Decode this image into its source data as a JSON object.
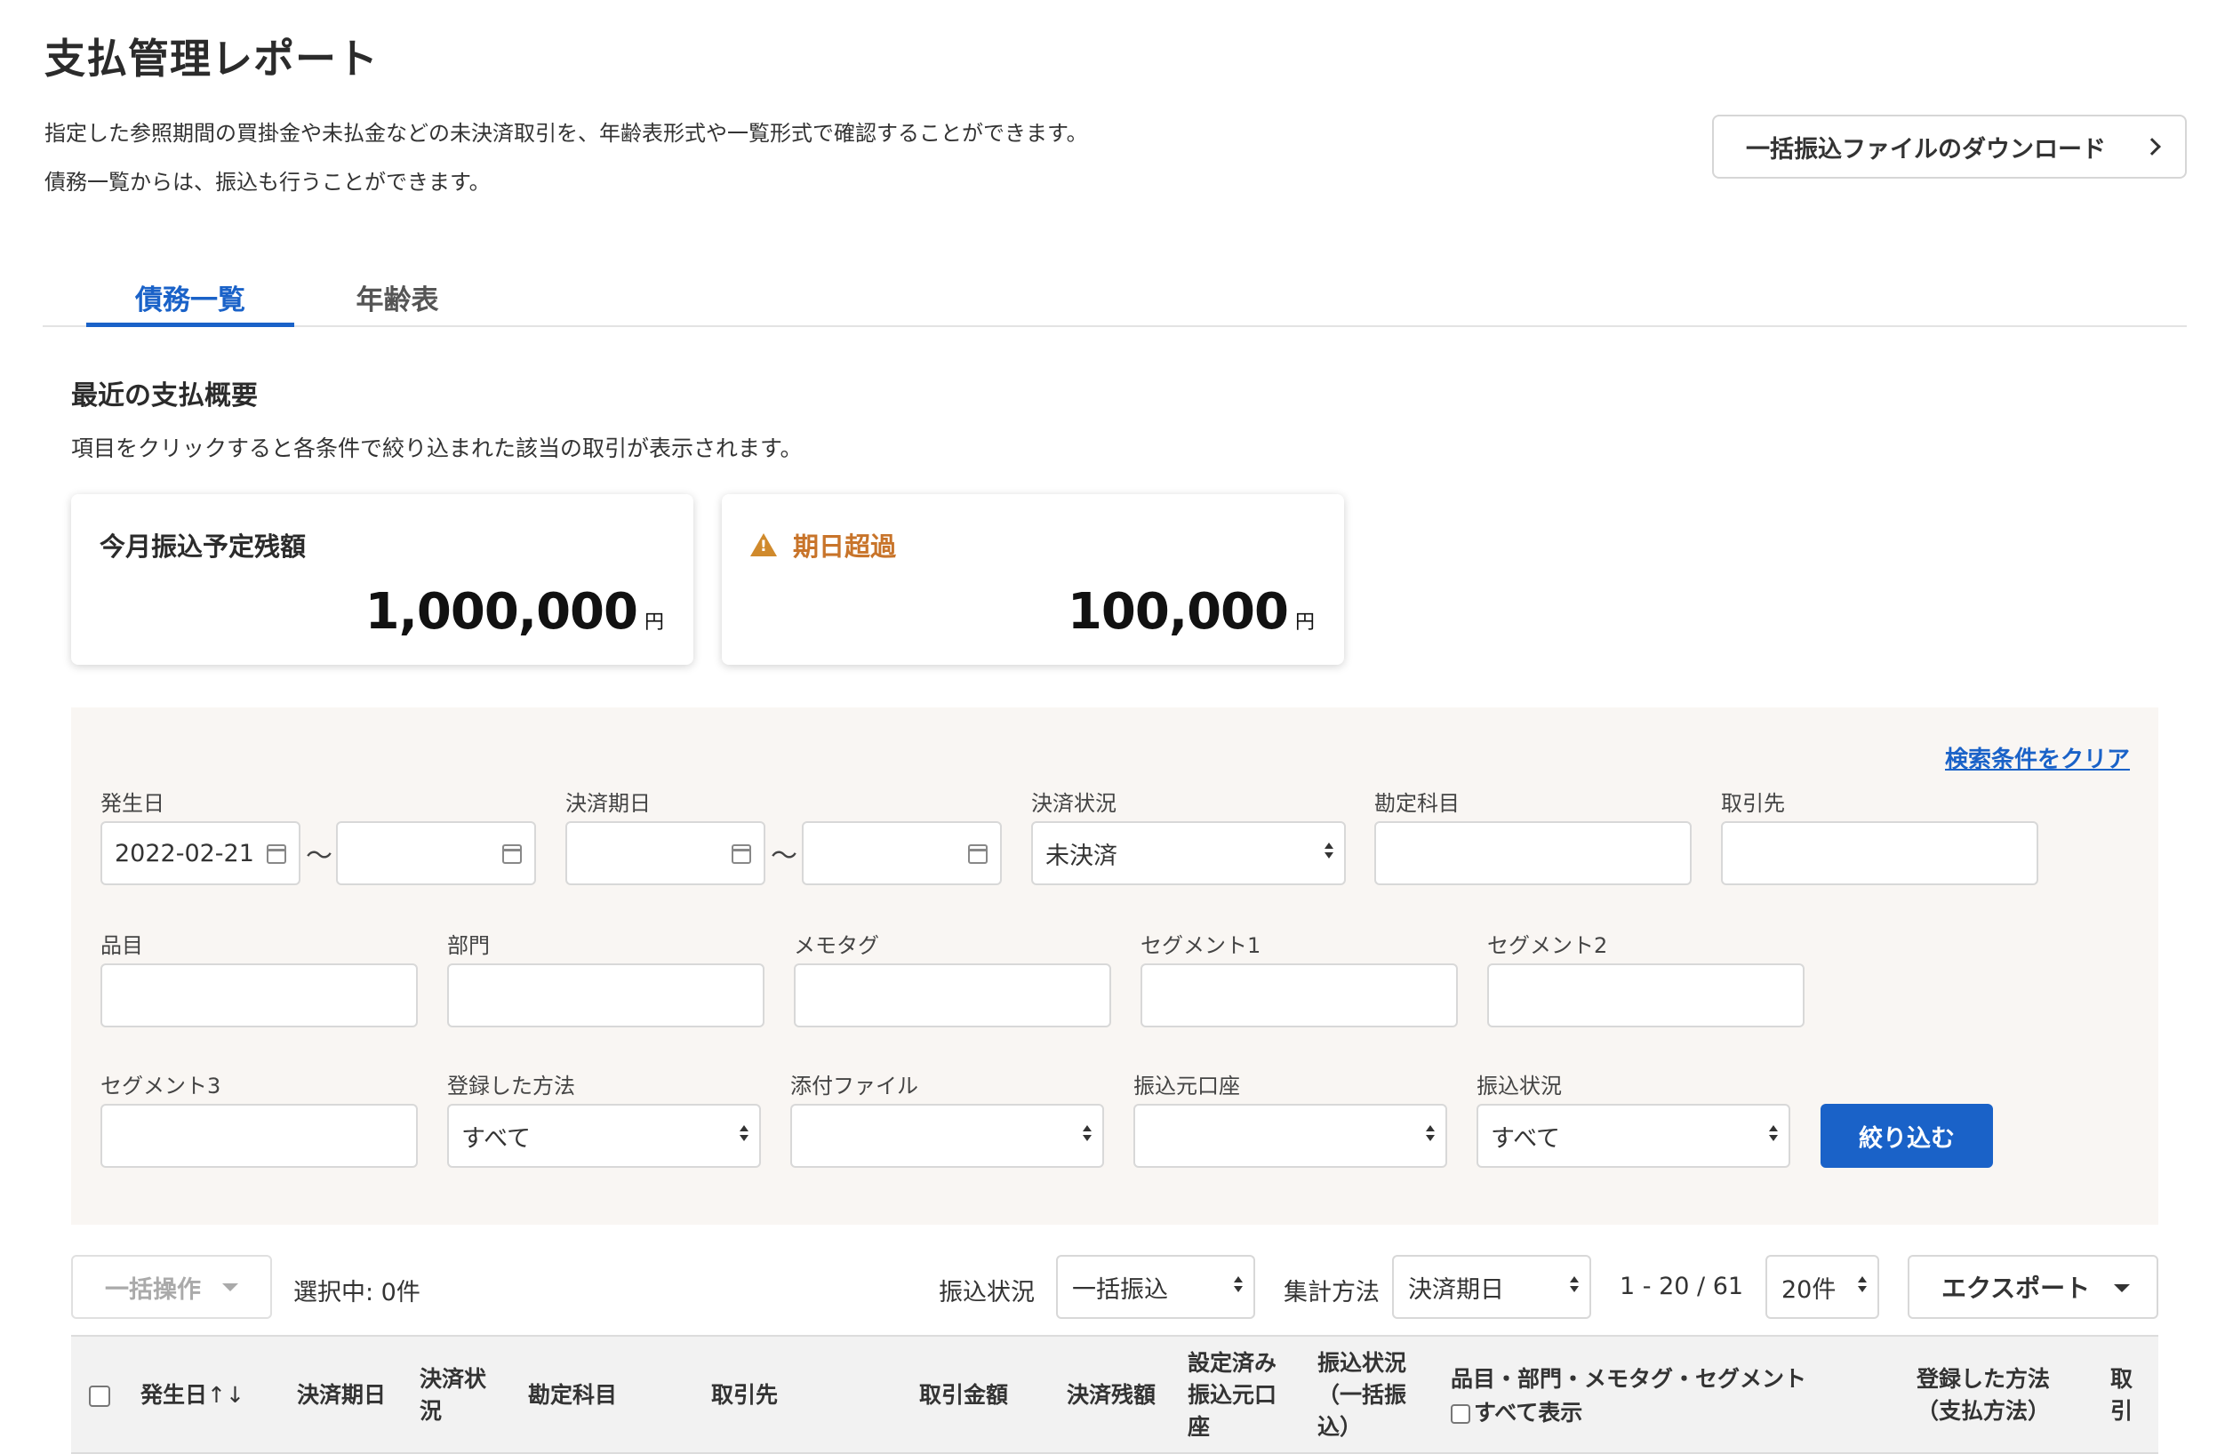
{
  "header": {
    "title": "支払管理レポート",
    "description_line1": "指定した参照期間の買掛金や未払金などの未決済取引を、年齢表形式や一覧形式で確認することができます。",
    "description_line2": "債務一覧からは、振込も行うことができます。",
    "download_button_label": "一括振込ファイルのダウンロード"
  },
  "tabs": [
    {
      "label": "債務一覧",
      "active": true
    },
    {
      "label": "年齢表",
      "active": false
    }
  ],
  "summary": {
    "title": "最近の支払概要",
    "description": "項目をクリックすると各条件で絞り込まれた該当の取引が表示されます。",
    "cards": [
      {
        "label": "今月振込予定残額",
        "value": "1,000,000",
        "unit": "円"
      },
      {
        "label": "期日超過",
        "value": "100,000",
        "unit": "円",
        "icon": "warning-icon"
      }
    ]
  },
  "filters": {
    "clear_label": "検索条件をクリア",
    "issue_date": {
      "label": "発生日",
      "from": "2022-02-21",
      "to": ""
    },
    "due_date": {
      "label": "決済期日",
      "from": "",
      "to": ""
    },
    "range_separator": "〜",
    "settlement_status": {
      "label": "決済状況",
      "value": "未決済"
    },
    "account_item": {
      "label": "勘定科目",
      "value": ""
    },
    "partner": {
      "label": "取引先",
      "value": ""
    },
    "item": {
      "label": "品目",
      "value": ""
    },
    "department": {
      "label": "部門",
      "value": ""
    },
    "memo_tag": {
      "label": "メモタグ",
      "value": ""
    },
    "segment1": {
      "label": "セグメント1",
      "value": ""
    },
    "segment2": {
      "label": "セグメント2",
      "value": ""
    },
    "segment3": {
      "label": "セグメント3",
      "value": ""
    },
    "registration_method": {
      "label": "登録した方法",
      "value": "すべて"
    },
    "attachment": {
      "label": "添付ファイル",
      "value": ""
    },
    "source_account": {
      "label": "振込元口座",
      "value": ""
    },
    "transfer_status": {
      "label": "振込状況",
      "value": "すべて"
    },
    "submit_label": "絞り込む"
  },
  "toolbar": {
    "bulk_action_label": "一括操作",
    "selected_text": "選択中: 0件",
    "transfer_status_label": "振込状況",
    "transfer_status_value": "一括振込",
    "aggregation_label": "集計方法",
    "aggregation_value": "決済期日",
    "pagination": "1 - 20 / 61",
    "per_page": "20件",
    "export_label": "エクスポート"
  },
  "table": {
    "columns": {
      "issue_date": "発生日",
      "sort_arrows": "↑↓",
      "due_date": "決済期日",
      "status_l1": "決済状",
      "status_l2": "況",
      "account": "勘定科目",
      "partner": "取引先",
      "amount": "取引金額",
      "balance": "決済残額",
      "src_l1": "設定済み",
      "src_l2": "振込元口",
      "src_l3": "座",
      "ts_l1": "振込状況",
      "ts_l2": "（一括振",
      "ts_l3": "込）",
      "tags": "品目・部門・メモタグ・セグメント",
      "show_all": "すべて表示",
      "method_l1": "登録した方法",
      "method_l2": "（支払方法）",
      "last_l1": "取",
      "last_l2": "引"
    }
  }
}
